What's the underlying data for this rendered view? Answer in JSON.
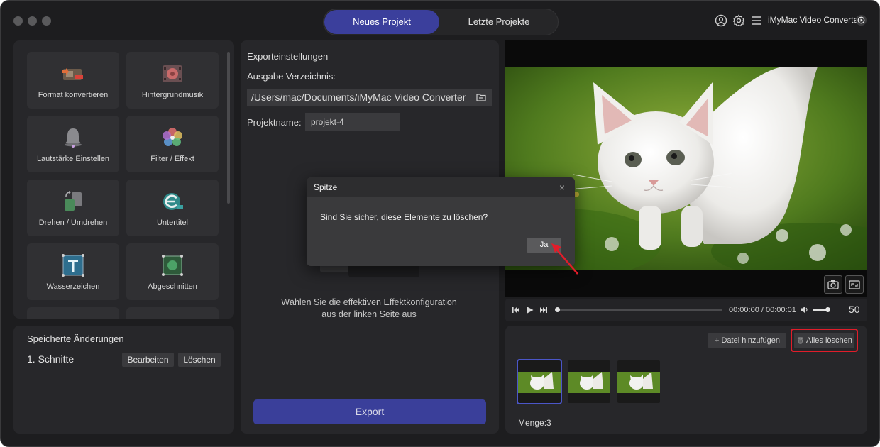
{
  "app": {
    "name": "iMyMac Video Converter"
  },
  "tabs": [
    {
      "label": "Neues Projekt",
      "active": true
    },
    {
      "label": "Letzte Projekte",
      "active": false
    }
  ],
  "tools": [
    {
      "label": "Format konvertieren",
      "icon": "format-convert-icon"
    },
    {
      "label": "Hintergrundmusik",
      "icon": "background-music-icon"
    },
    {
      "label": "Lautstärke Einstellen",
      "icon": "volume-bell-icon"
    },
    {
      "label": "Filter / Effekt",
      "icon": "filter-effect-icon"
    },
    {
      "label": "Drehen / Umdrehen",
      "icon": "rotate-icon"
    },
    {
      "label": "Untertitel",
      "icon": "subtitle-icon"
    },
    {
      "label": "Wasserzeichen",
      "icon": "watermark-icon"
    },
    {
      "label": "Abgeschnitten",
      "icon": "crop-icon"
    }
  ],
  "saved": {
    "title": "Speicherte Änderungen",
    "item": "1. Schnitte",
    "edit_label": "Bearbeiten",
    "delete_label": "Löschen"
  },
  "export": {
    "heading": "Exporteinstellungen",
    "dir_label": "Ausgabe Verzeichnis:",
    "dir_value": "/Users/mac/Documents/iMyMac Video Converter",
    "name_label": "Projektname:",
    "name_value": "projekt-4",
    "hint_line1": "Wählen Sie die effektiven Effektkonfiguration",
    "hint_line2": "aus der linken Seite aus",
    "button_label": "Export"
  },
  "player": {
    "time": "00:00:00 / 00:00:01",
    "volume": "50"
  },
  "files": {
    "add_label": "Datei hinzufügen",
    "clear_label": "Alles löschen",
    "count_label": "Menge:3"
  },
  "dialog": {
    "title": "Spitze",
    "message": "Sind Sie sicher, diese Elemente zu löschen?",
    "confirm_label": "Ja"
  },
  "colors": {
    "accent": "#3b3f9c",
    "highlight": "#e11d2a"
  }
}
